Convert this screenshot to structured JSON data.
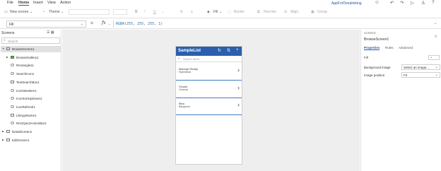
{
  "menu": {
    "items": [
      "File",
      "Home",
      "Insert",
      "View",
      "Action"
    ],
    "active": "Home",
    "app_name": "AppForDeeplinking"
  },
  "ribbon": {
    "new_screen": "New screen",
    "theme": "Theme",
    "fill": "Fill",
    "border": "Border",
    "reorder": "Reorder",
    "align": "Align",
    "group": "Group"
  },
  "formula_bar": {
    "property": "Fill",
    "formula": "RGBA(255, 255, 255, 1)"
  },
  "left_panel": {
    "title": "Screens",
    "search_placeholder": "Search",
    "tree": [
      {
        "label": "BrowseScreen1",
        "level": 0,
        "caret": "▼",
        "icon": "screen",
        "selected": true
      },
      {
        "label": "BrowseGallery1",
        "level": 1,
        "caret": "▶",
        "icon": "gallery"
      },
      {
        "label": "Rectangle11",
        "level": 1,
        "caret": "",
        "icon": "shape"
      },
      {
        "label": "SearchIcon1",
        "level": 1,
        "caret": "",
        "icon": "shape"
      },
      {
        "label": "TextSearchBox1",
        "level": 1,
        "caret": "",
        "icon": "box"
      },
      {
        "label": "IconNewItem1",
        "level": 1,
        "caret": "",
        "icon": "shape"
      },
      {
        "label": "IconSortUpDown1",
        "level": 1,
        "caret": "",
        "icon": "shape"
      },
      {
        "label": "IconRefresh1",
        "level": 1,
        "caret": "",
        "icon": "shape"
      },
      {
        "label": "LblAppName1",
        "level": 1,
        "caret": "",
        "icon": "box"
      },
      {
        "label": "RectQuickActionBar1",
        "level": 1,
        "caret": "",
        "icon": "shape"
      },
      {
        "label": "DetailScreen1",
        "level": 0,
        "caret": "▶",
        "icon": "screen"
      },
      {
        "label": "EditScreen1",
        "level": 0,
        "caret": "▶",
        "icon": "screen"
      }
    ]
  },
  "phone": {
    "title": "SampleList",
    "search_placeholder": "Search items",
    "items": [
      {
        "title": "Mamoje Reddy",
        "subtitle": "Hyderabad"
      },
      {
        "title": "Vinush",
        "subtitle": "Chennai"
      },
      {
        "title": "Binu",
        "subtitle": "Bangalore"
      }
    ]
  },
  "right_panel": {
    "type_label": "SCREEN",
    "name": "BrowseScreen1",
    "tabs": [
      "Properties",
      "Rules",
      "Advanced"
    ],
    "active_tab": "Properties",
    "fill_label": "Fill",
    "background_image_label": "Background image",
    "background_image_value": "Select an image...",
    "image_position_label": "Image position",
    "image_position_value": "Fit"
  },
  "colors": {
    "accent": "#2b579a",
    "phone_header": "#2b5fad",
    "gallery_separator": "#3c7dc4",
    "canvas": "#eeeeee"
  }
}
